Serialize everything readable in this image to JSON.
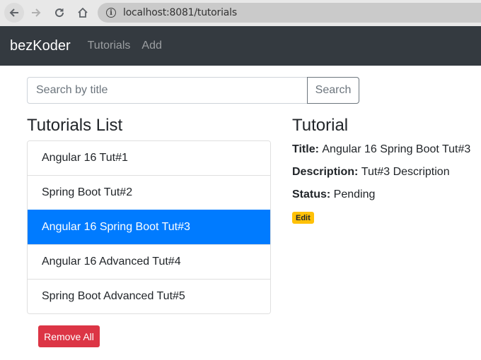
{
  "browser": {
    "url": "localhost:8081/tutorials",
    "icons": {
      "back": "arrow-left-icon",
      "forward": "arrow-right-icon",
      "reload": "reload-icon",
      "home": "home-icon",
      "info": "info-icon"
    }
  },
  "navbar": {
    "brand": "bezKoder",
    "links": [
      {
        "label": "Tutorials"
      },
      {
        "label": "Add"
      }
    ]
  },
  "search": {
    "placeholder": "Search by title",
    "value": "",
    "button_label": "Search"
  },
  "tutorials_list": {
    "title": "Tutorials List",
    "items": [
      {
        "title": "Angular 16 Tut#1",
        "active": false
      },
      {
        "title": "Spring Boot Tut#2",
        "active": false
      },
      {
        "title": "Angular 16 Spring Boot Tut#3",
        "active": true
      },
      {
        "title": "Angular 16 Advanced Tut#4",
        "active": false
      },
      {
        "title": "Spring Boot Advanced Tut#5",
        "active": false
      }
    ],
    "remove_all_label": "Remove All"
  },
  "tutorial_detail": {
    "heading": "Tutorial",
    "title_label": "Title:",
    "title_value": "Angular 16 Spring Boot Tut#3",
    "description_label": "Description:",
    "description_value": "Tut#3 Description",
    "status_label": "Status:",
    "status_value": "Pending",
    "edit_label": "Edit"
  },
  "colors": {
    "navbar_bg": "#343a40",
    "active_item": "#007bff",
    "danger": "#dc3545",
    "warning": "#ffc107"
  }
}
